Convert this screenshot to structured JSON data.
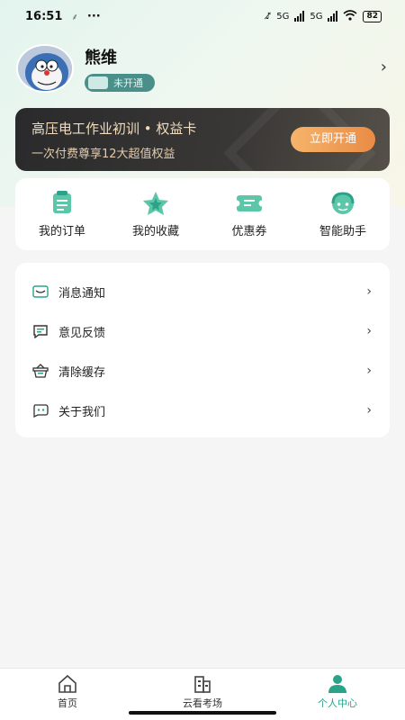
{
  "status_bar": {
    "time": "16:51",
    "signal_1": "5G",
    "signal_2": "5G",
    "battery": "82"
  },
  "profile": {
    "name": "熊维",
    "member_status": "未开通"
  },
  "vip_card": {
    "title": "高压电工作业初训 • 权益卡",
    "subtitle": "一次付费尊享12大超值权益",
    "cta": "立即开通"
  },
  "quick_actions": [
    {
      "label": "我的订单",
      "icon": "order-icon"
    },
    {
      "label": "我的收藏",
      "icon": "star-icon"
    },
    {
      "label": "优惠券",
      "icon": "coupon-icon"
    },
    {
      "label": "智能助手",
      "icon": "assistant-icon"
    }
  ],
  "menu": [
    {
      "label": "消息通知",
      "icon": "message-icon"
    },
    {
      "label": "意见反馈",
      "icon": "feedback-icon"
    },
    {
      "label": "清除缓存",
      "icon": "basket-icon"
    },
    {
      "label": "关于我们",
      "icon": "about-icon"
    }
  ],
  "tab_bar": {
    "tabs": [
      {
        "label": "首页",
        "icon": "home-icon"
      },
      {
        "label": "云看考场",
        "icon": "building-icon"
      },
      {
        "label": "个人中心",
        "icon": "person-icon"
      }
    ],
    "active_index": 2
  },
  "colors": {
    "accent": "#2aa389",
    "vip_gold": "#f1d9b5",
    "cta_orange": "#e98b45"
  }
}
